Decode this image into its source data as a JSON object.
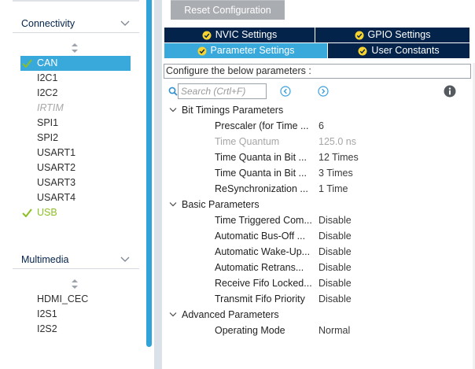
{
  "categories": {
    "connectivity": {
      "title": "Connectivity",
      "items": [
        {
          "label": "CAN",
          "state": "selected-ok"
        },
        {
          "label": "I2C1",
          "state": "normal"
        },
        {
          "label": "I2C2",
          "state": "normal"
        },
        {
          "label": "IRTIM",
          "state": "disabled"
        },
        {
          "label": "SPI1",
          "state": "normal"
        },
        {
          "label": "SPI2",
          "state": "normal"
        },
        {
          "label": "USART1",
          "state": "normal"
        },
        {
          "label": "USART2",
          "state": "normal"
        },
        {
          "label": "USART3",
          "state": "normal"
        },
        {
          "label": "USART4",
          "state": "normal"
        },
        {
          "label": "USB",
          "state": "ok"
        }
      ]
    },
    "multimedia": {
      "title": "Multimedia",
      "items": [
        {
          "label": "HDMI_CEC",
          "state": "normal"
        },
        {
          "label": "I2S1",
          "state": "normal"
        },
        {
          "label": "I2S2",
          "state": "normal"
        }
      ]
    }
  },
  "config": {
    "reset_label": "Reset Configuration",
    "tabs": [
      {
        "label": "NVIC Settings",
        "active": false
      },
      {
        "label": "GPIO Settings",
        "active": false
      },
      {
        "label": "Parameter Settings",
        "active": true
      },
      {
        "label": "User Constants",
        "active": false
      }
    ],
    "instructions": "Configure the below parameters :",
    "search_placeholder": "Search (Crtl+F)",
    "groups": [
      {
        "title": "Bit Timings Parameters",
        "params": [
          {
            "name": "Prescaler (for Time ...",
            "value": "6",
            "readonly": false
          },
          {
            "name": "Time Quantum",
            "value": "125.0 ns",
            "readonly": true
          },
          {
            "name": "Time Quanta in Bit ...",
            "value": "12 Times",
            "readonly": false
          },
          {
            "name": "Time Quanta in Bit ...",
            "value": "3 Times",
            "readonly": false
          },
          {
            "name": "ReSynchronization ...",
            "value": "1 Time",
            "readonly": false
          }
        ]
      },
      {
        "title": "Basic Parameters",
        "params": [
          {
            "name": "Time Triggered Com...",
            "value": "Disable",
            "readonly": false
          },
          {
            "name": "Automatic Bus-Off ...",
            "value": "Disable",
            "readonly": false
          },
          {
            "name": "Automatic Wake-Up...",
            "value": "Disable",
            "readonly": false
          },
          {
            "name": "Automatic Retrans...",
            "value": "Disable",
            "readonly": false
          },
          {
            "name": "Receive Fifo Locked...",
            "value": "Disable",
            "readonly": false
          },
          {
            "name": "Transmit Fifo Priority",
            "value": "Disable",
            "readonly": false
          }
        ]
      },
      {
        "title": "Advanced Parameters",
        "params": [
          {
            "name": "Operating Mode",
            "value": "Normal",
            "readonly": false
          }
        ]
      }
    ]
  },
  "colors": {
    "accent": "#39a9dc",
    "navy": "#03234b",
    "ok_green": "#8cbf24",
    "reset_gray": "#a9adb1"
  },
  "icons": [
    "chevron-down-icon",
    "sort-icon",
    "check-icon",
    "search-icon",
    "previous-icon",
    "next-icon",
    "info-icon"
  ]
}
